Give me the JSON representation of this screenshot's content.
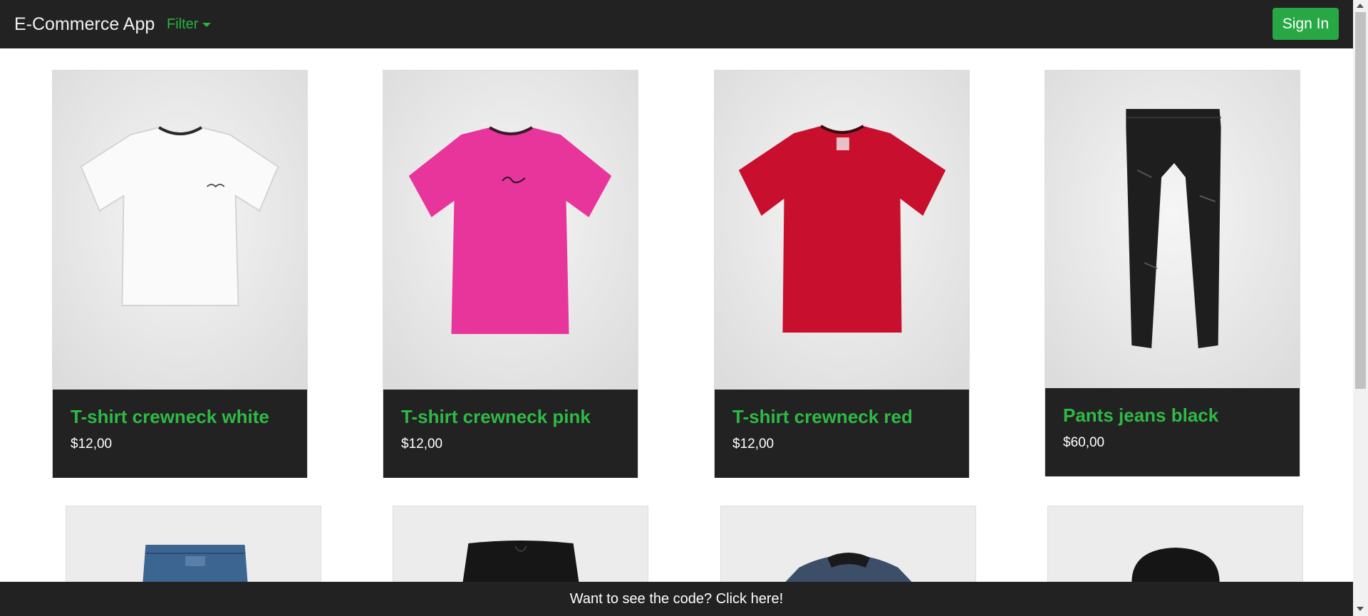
{
  "navbar": {
    "brand": "E-Commerce App",
    "filter_label": "Filter",
    "signin_label": "Sign In"
  },
  "products": [
    {
      "title": "T-shirt crewneck white",
      "price": "$12,00",
      "image": "white-tshirt",
      "color": "#f7f7f7"
    },
    {
      "title": "T-shirt crewneck pink",
      "price": "$12,00",
      "image": "pink-tshirt",
      "color": "#e8359b"
    },
    {
      "title": "T-shirt crewneck red",
      "price": "$12,00",
      "image": "red-tshirt",
      "color": "#c8102e"
    },
    {
      "title": "Pants jeans black",
      "price": "$60,00",
      "image": "black-jeans",
      "color": "#1e1e1e"
    },
    {
      "image": "blue-jeans",
      "color": "#3d6591"
    },
    {
      "image": "black-joggers",
      "color": "#161616"
    },
    {
      "image": "denim-jacket",
      "color": "#3c4e68"
    },
    {
      "image": "black-beanie",
      "color": "#151515"
    }
  ],
  "footer": {
    "text": "Want to see the code? Click here!"
  },
  "colors": {
    "accent": "#28a745",
    "link": "#2fb946",
    "dark": "#222222"
  }
}
